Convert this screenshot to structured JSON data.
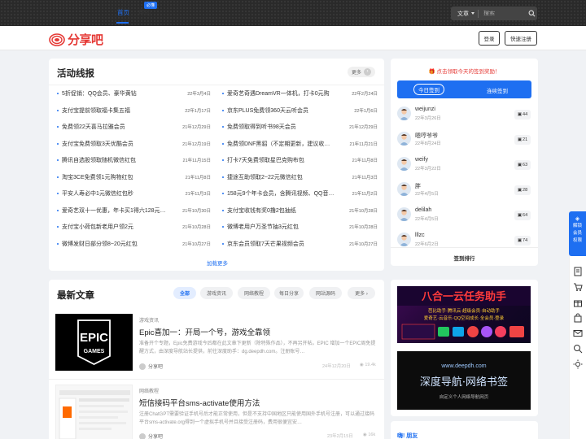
{
  "topbar": {
    "search_type": "文章",
    "search_placeholder": "搜索"
  },
  "header": {
    "logo_text": "分享吧",
    "nav_home": "首页",
    "nav_help": "帮助",
    "nav_help_badge": "必懂",
    "login_label": "登录",
    "register_label": "快速注册"
  },
  "deals": {
    "title": "活动线报",
    "more_label": "更多",
    "load_more": "加载更多",
    "left": [
      {
        "text": "5折促销：QQ会员、豪华黄钻",
        "date": "22年3月4日"
      },
      {
        "text": "支付宝提前领取福卡集五福",
        "date": "22年1月17日"
      },
      {
        "text": "免费领22天喜马拉雅会员",
        "date": "21年12月29日"
      },
      {
        "text": "支付宝免费领取3天优酷会员",
        "date": "21年12月19日"
      },
      {
        "text": "腾讯自选股领取随机微信红包",
        "date": "21年11月15日"
      },
      {
        "text": "淘宝3CE免费领1元购物红包",
        "date": "21年11月8日"
      },
      {
        "text": "平安人寿必中1元微信红包秒",
        "date": "21年11月3日"
      },
      {
        "text": "爱奇艺双十一优惠，年卡买1得六128元…",
        "date": "21年10月30日"
      },
      {
        "text": "支付宝小荷包新老用户领2元",
        "date": "21年10月28日"
      },
      {
        "text": "微博发财日部分领8~20元红包",
        "date": "21年10月27日"
      }
    ],
    "right": [
      {
        "text": "爱奇艺奇遇DreamVR一体机，打卡0元购",
        "date": "22年2月24日"
      },
      {
        "text": "京东PLUS免费领360天云听会员",
        "date": "22年1月6日"
      },
      {
        "text": "免费领取得到听书98天会员",
        "date": "21年12月29日"
      },
      {
        "text": "免费领DNF黑貂（不定期更新，建议收…",
        "date": "21年11月21日"
      },
      {
        "text": "打卡7天免费领取星巴克购布包",
        "date": "21年11月8日"
      },
      {
        "text": "捷途互助领取2~22元微信红包",
        "date": "21年11月3日"
      },
      {
        "text": "158元9个年卡会员，含腾讯视频、QQ音…",
        "date": "21年11月2日"
      },
      {
        "text": "支付宝收钱有奖0撸2包抽纸",
        "date": "21年10月28日"
      },
      {
        "text": "微博老用户万圣节抽3元红包",
        "date": "21年10月28日"
      },
      {
        "text": "京东会员领取7天芒果视频会员",
        "date": "21年10月27日"
      }
    ]
  },
  "signin": {
    "tip": "点击领取今天的签到奖励！",
    "tab_today": "今日签到",
    "tab_streak": "连续签到",
    "users": [
      {
        "name": "weijunzi",
        "date": "22年3月26日",
        "count": "44"
      },
      {
        "name": "嗯哼爷爷",
        "date": "22年8月24日",
        "count": "21"
      },
      {
        "name": "weify",
        "date": "22年3月22日",
        "count": "63"
      },
      {
        "name": "胖",
        "date": "22年4月5日",
        "count": "28"
      },
      {
        "name": "delilah",
        "date": "22年4月5日",
        "count": "64"
      },
      {
        "name": "lllzc",
        "date": "22年6月2日",
        "count": "74"
      }
    ],
    "rank_link": "签到排行"
  },
  "articles": {
    "title": "最新文章",
    "filters": [
      "全部",
      "游戏资讯",
      "网络教程",
      "每日分享",
      "网站源码",
      "更多"
    ],
    "items": [
      {
        "category": "游戏资讯",
        "title": "Epic喜加一：开局一个号，游戏全靠领",
        "desc": "准备开个专题，Epic免费游戏今后都在此文章下更新（除特殊作品），不再另开帖。EPIC 增加一个EPIC周免提醒方式，由深度导航站长提供，前往深度助手：dg.deepdh.com。注册账号…",
        "author": "分享吧",
        "date": "24年12月20日",
        "views": "19.4k",
        "thumb_word": "EPIC",
        "thumb_sub": "GAMES"
      },
      {
        "category": "网络教程",
        "title": "短信接码平台sms-activate使用方法",
        "desc": "注册ChatGPT需要验证手机号后才能正常使用，但是不支持中国地区只能使用国外手机号注册，可以通过接码平台sms-activate.org得到一个虚拟手机号并且接受注册码，费用很便宜安…",
        "author": "分享吧",
        "date": "23年2月15日",
        "views": "16k"
      }
    ]
  },
  "banners": {
    "banner1_title": "八合一云任务助手",
    "banner1_sub": "芭比助手·腾讯云·超级会员·自动助手",
    "banner1_line2": "爱奇艺·云音乐·QQ空间成长·全会员·登录",
    "banner2_url": "www.deepdh.com",
    "banner2_title": "深度导航·网络书签",
    "banner2_sub": "自定义个人网络导航网页"
  },
  "friends": {
    "title": "嗨! 朋友"
  },
  "float": {
    "primary_label": "解锁会员权限"
  },
  "colors": {
    "accent": "#1e6ff1",
    "brand": "#e53935",
    "topbar": "#2a2a2a"
  }
}
